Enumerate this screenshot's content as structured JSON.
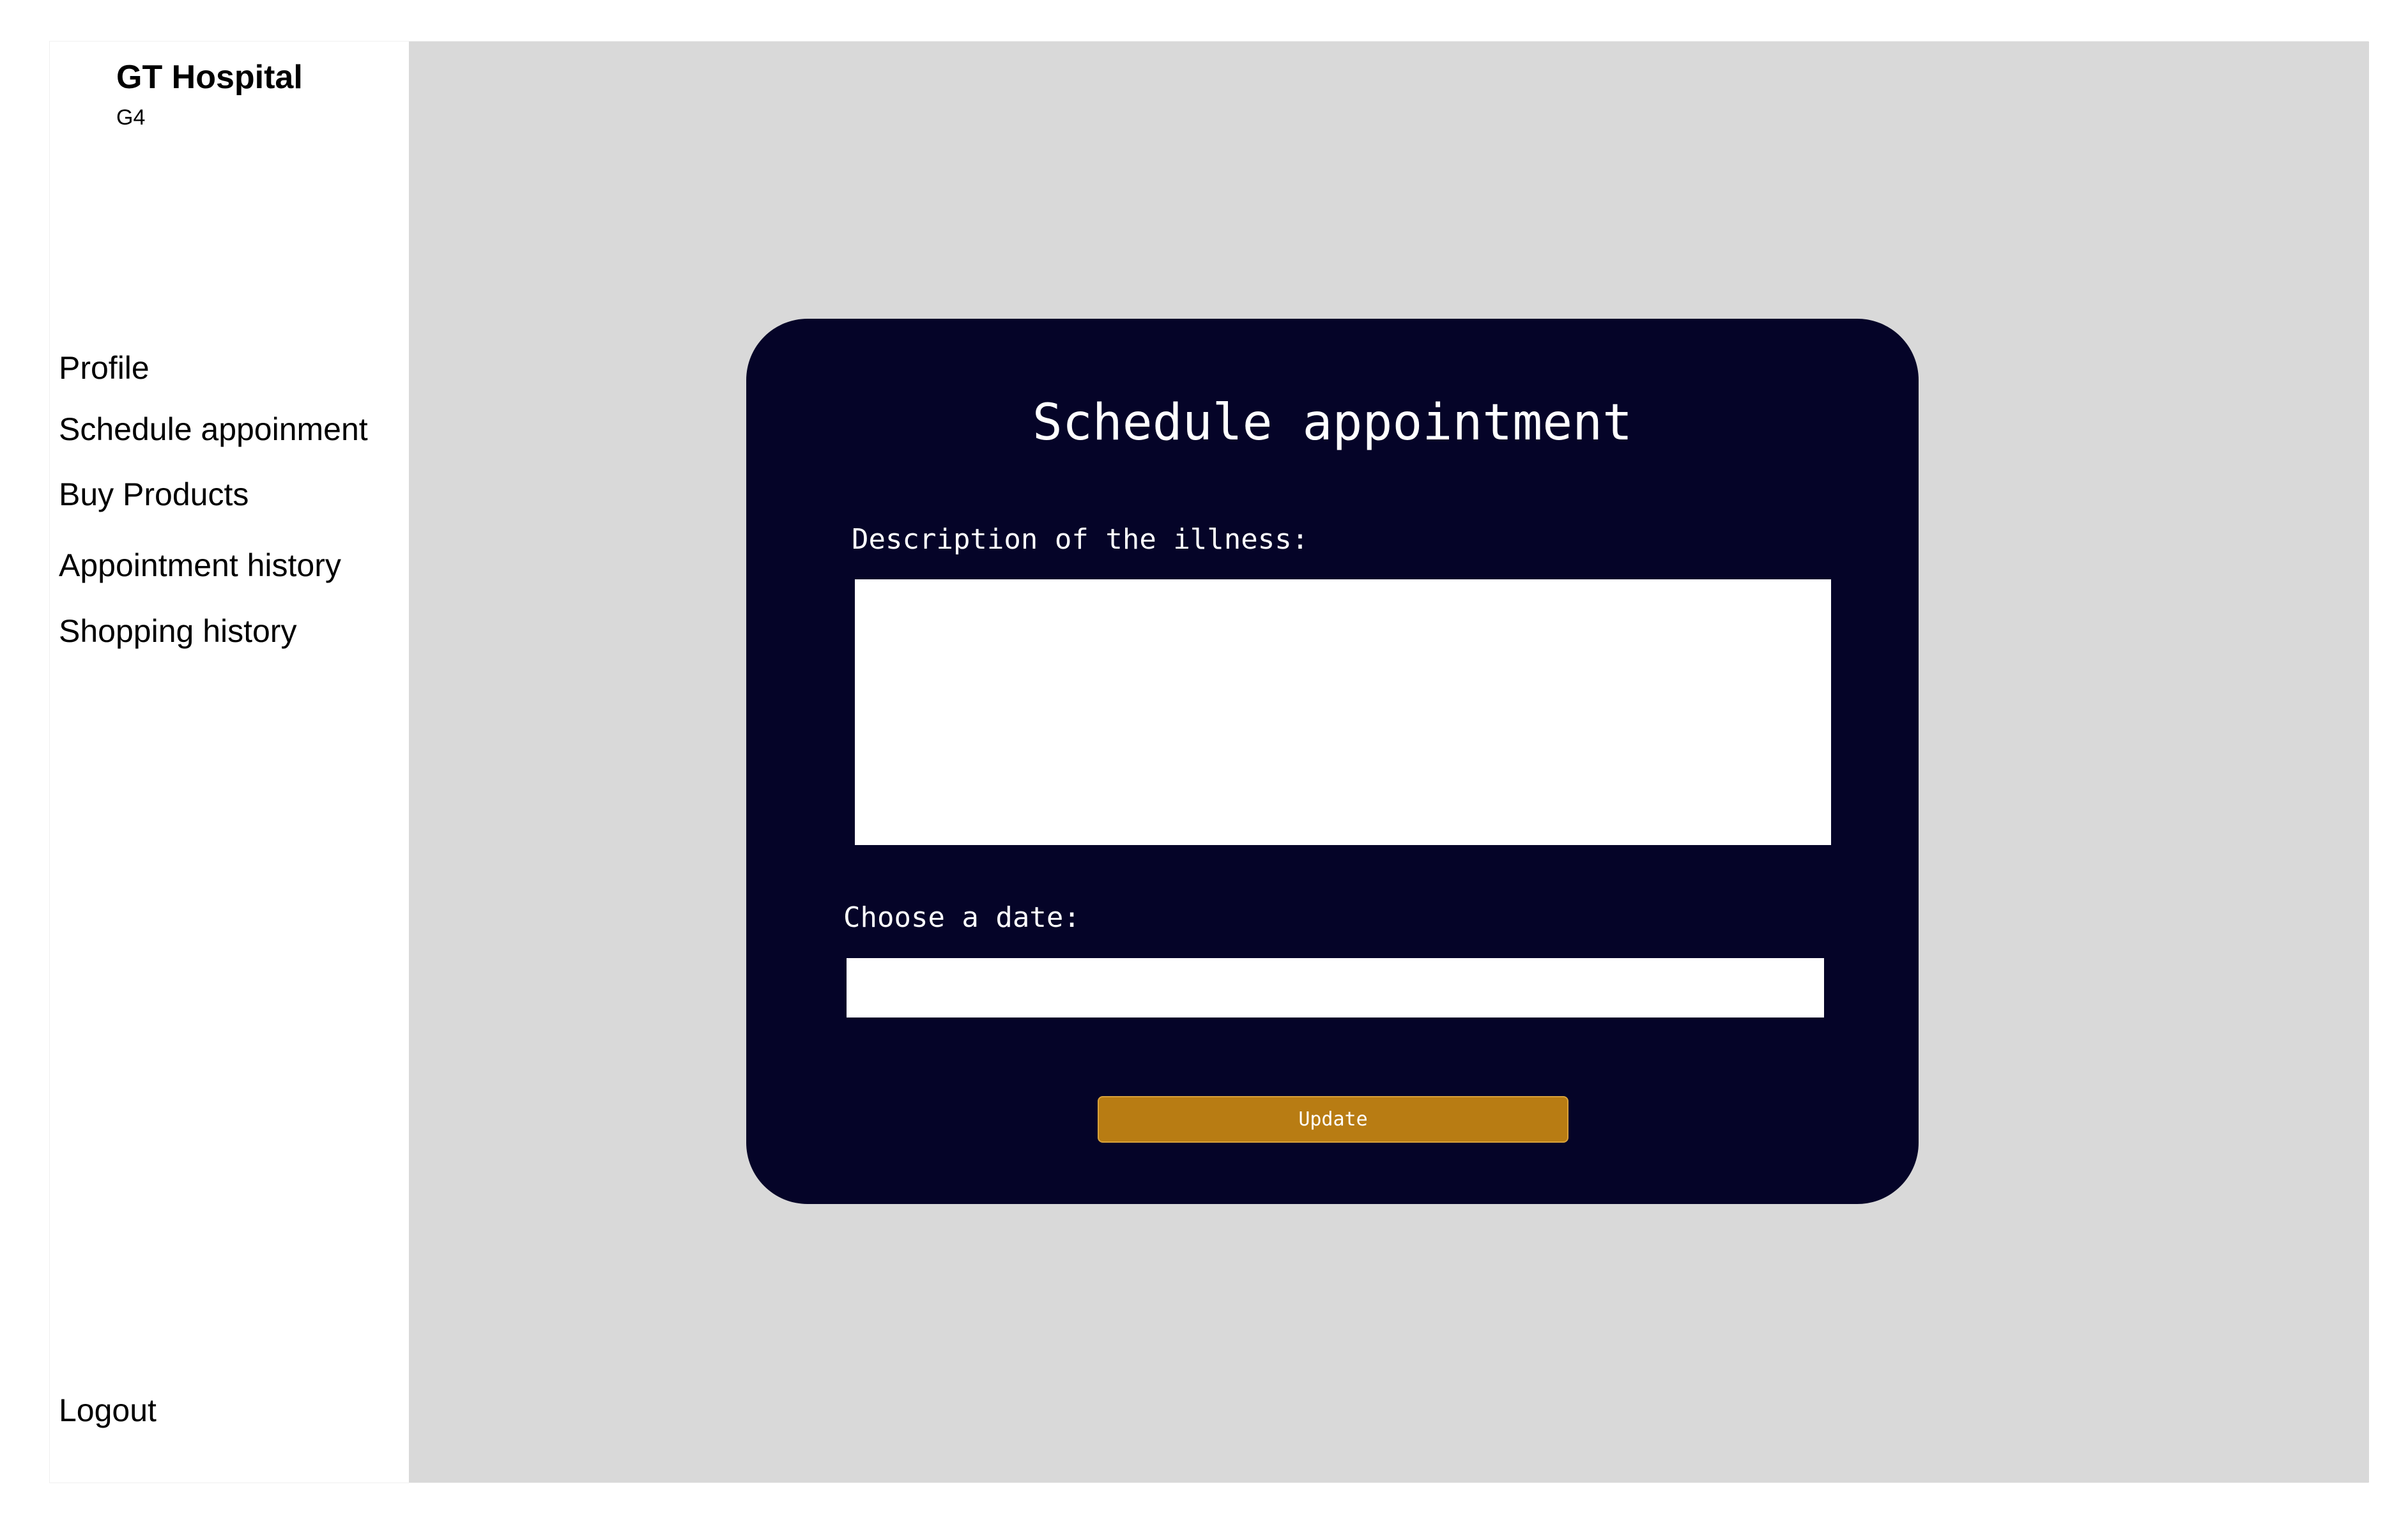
{
  "sidebar": {
    "brand_title": "GT Hospital",
    "brand_subtitle": "G4",
    "nav_items": [
      {
        "label": "Profile"
      },
      {
        "label": "Schedule appoinment"
      },
      {
        "label": "Buy Products"
      },
      {
        "label": "Appointment history"
      },
      {
        "label": "Shopping history"
      }
    ],
    "logout_label": "Logout"
  },
  "form": {
    "title": "Schedule appointment",
    "description_label": "Description of the illness:",
    "description_value": "",
    "date_label": "Choose a date:",
    "date_value": "",
    "submit_label": "Update"
  },
  "colors": {
    "card_background": "#050428",
    "page_background": "#d9d9d9",
    "button_accent": "#b87c13"
  }
}
